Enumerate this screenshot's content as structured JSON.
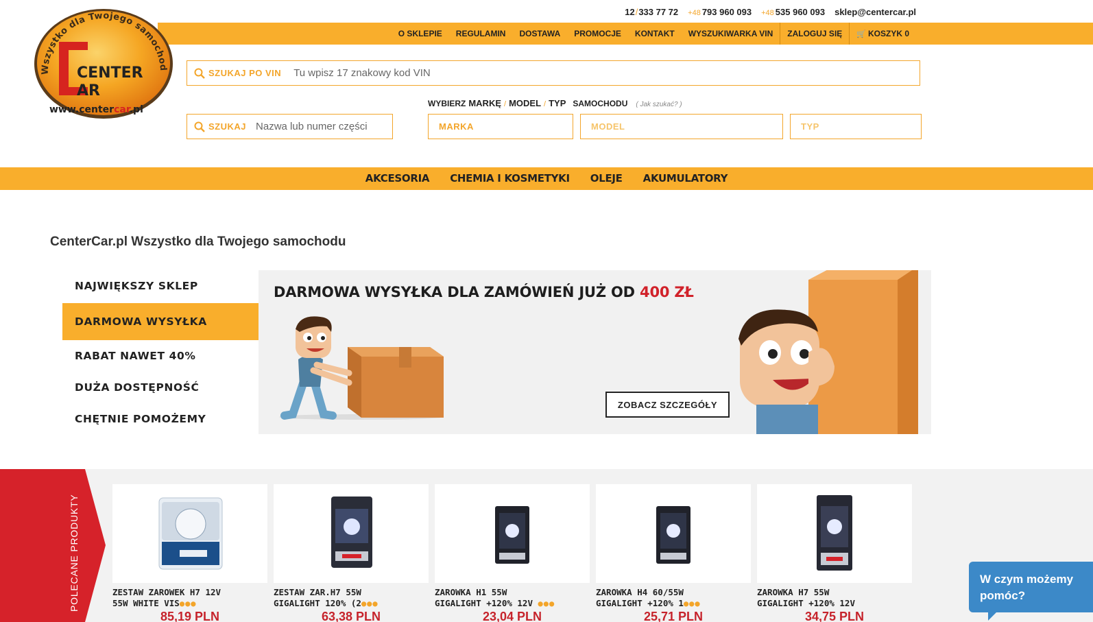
{
  "contact": {
    "phone1_prefix": "12",
    "phone1_number": "333 77 72",
    "phone2_prefix": "+48",
    "phone2_number": "793 960 093",
    "phone3_prefix": "+48",
    "phone3_number": "535 960 093",
    "email": "sklep@centercar.pl"
  },
  "topnav": {
    "items": [
      "O SKLEPIE",
      "REGULAMIN",
      "DOSTAWA",
      "PROMOCJE",
      "KONTAKT",
      "WYSZUKIWARKA VIN"
    ],
    "login": "ZALOGUJ SIĘ",
    "cart": "KOSZYK 0"
  },
  "logo": {
    "ring_text": "Wszystko dla Twojego samochodu",
    "center": "CENTER",
    "car": "AR",
    "url_prefix": "www.center",
    "url_mid": "car",
    "url_suffix": ".pl"
  },
  "search": {
    "vin_label": "SZUKAJ PO VIN",
    "vin_placeholder": "Tu wpisz 17 znakowy kod VIN",
    "part_label": "SZUKAJ",
    "part_placeholder": "Nazwa lub numer części"
  },
  "vehicle": {
    "choose": "WYBIERZ",
    "brand_word": "MARKĘ",
    "model_word": "MODEL",
    "type_word": "TYP",
    "car_word": "SAMOCHODU",
    "how": "( Jak szukać? )",
    "select_brand": "MARKA",
    "select_model": "MODEL",
    "select_type": "TYP"
  },
  "categories": [
    "AKCESORIA",
    "CHEMIA I KOSMETYKI",
    "OLEJE",
    "AKUMULATORY"
  ],
  "tagline": "CenterCar.pl Wszystko dla Twojego samochodu",
  "features": [
    "NAJWIĘKSZY SKLEP",
    "DARMOWA WYSYŁKA",
    "RABAT NAWET 40%",
    "DUŻA DOSTĘPNOŚĆ",
    "CHĘTNIE POMOŻEMY"
  ],
  "banner": {
    "headline": "DARMOWA WYSYŁKA DLA ZAMÓWIEŃ JUŻ OD ",
    "amount": "400 ZŁ",
    "button": "ZOBACZ SZCZEGÓŁY"
  },
  "recommended": {
    "label": "POLECANE PRODUKTY",
    "products": [
      {
        "name1": "ZESTAW ZAROWEK H7 12V",
        "name2": "55W WHITE VIS",
        "price": "85,19 PLN"
      },
      {
        "name1": "ZESTAW ZAR.H7 55W",
        "name2": "GIGALIGHT 120% (2",
        "price": "63,38 PLN"
      },
      {
        "name1": "ZAROWKA H1 55W",
        "name2": "GIGALIGHT +120% 12V",
        "price": "23,04 PLN"
      },
      {
        "name1": "ZAROWKA H4 60/55W",
        "name2": "GIGALIGHT +120% 1",
        "price": "25,71 PLN"
      },
      {
        "name1": "ZAROWKA H7 55W",
        "name2": "GIGALIGHT +120% 12V",
        "price": "34,75 PLN"
      }
    ]
  },
  "chat": {
    "line1": "W czym możemy",
    "line2": "pomóc?"
  },
  "colors": {
    "orange": "#f9ae2c",
    "red": "#d1222a",
    "blue": "#3c89c8"
  }
}
